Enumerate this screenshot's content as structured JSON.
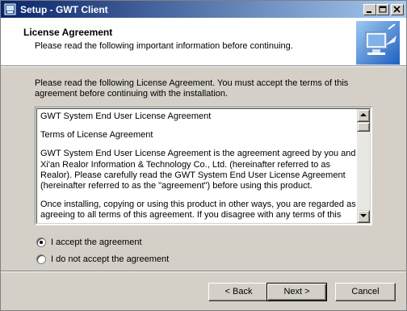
{
  "window": {
    "title": "Setup - GWT Client",
    "controls": [
      "minimize",
      "maximize",
      "close"
    ]
  },
  "header": {
    "title": "License Agreement",
    "subtitle": "Please read the following important information before continuing."
  },
  "intro": "Please read the following License Agreement. You must accept the terms of this agreement before continuing with the installation.",
  "license": {
    "paragraphs": [
      "GWT System End User License Agreement",
      "Terms of License Agreement",
      "GWT System End User License Agreement is the agreement agreed by you and Xi'an Realor Information & Technology Co., Ltd. (hereinafter referred to as Realor). Please carefully read the GWT System End User License Agreement (hereinafter referred to as the \"agreement\") before using this product.",
      "Once installing, copying or using this product in other ways, you are regarded as agreeing to all terms of this agreement. If you disagree with any terms of this"
    ]
  },
  "options": {
    "accept": "I accept the agreement",
    "decline": "I do not accept the agreement",
    "selected": "accept"
  },
  "buttons": {
    "back": "< Back",
    "next": "Next >",
    "cancel": "Cancel"
  }
}
